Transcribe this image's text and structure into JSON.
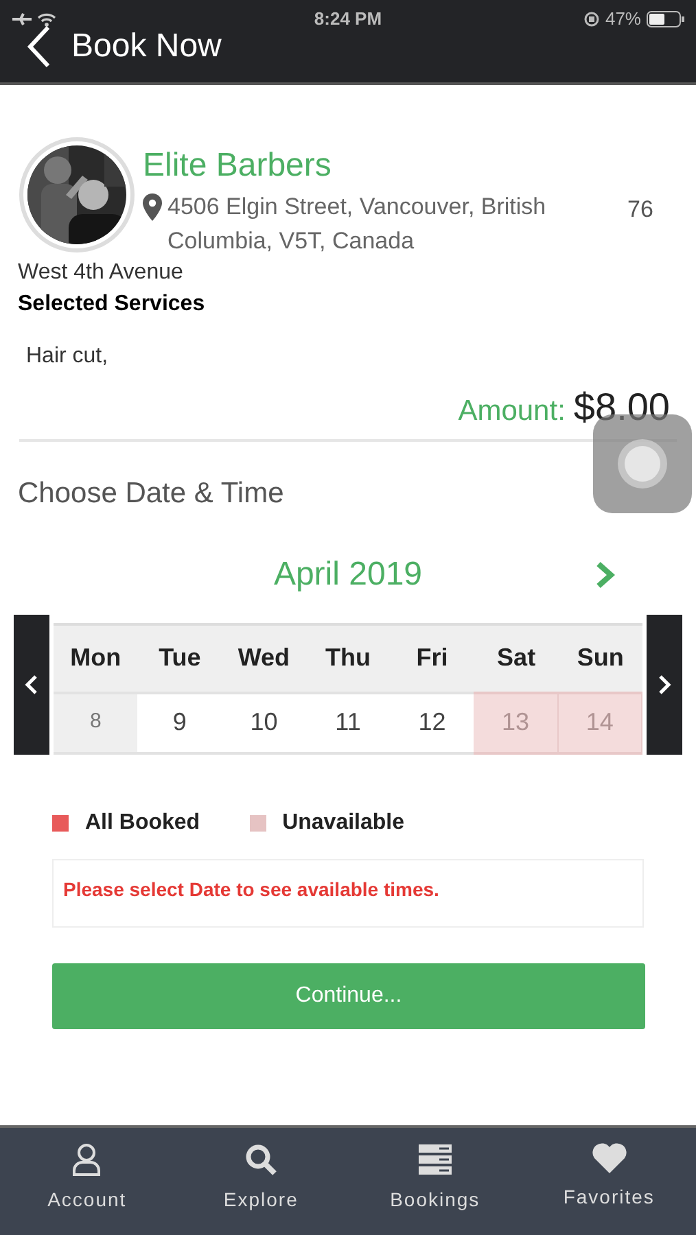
{
  "status_bar": {
    "time": "8:24 PM",
    "battery": "47%"
  },
  "header": {
    "title": "Book Now"
  },
  "shop": {
    "name": "Elite Barbers",
    "address": "4506 Elgin Street, Vancouver, British Columbia, V5T, Canada",
    "count": "76",
    "area": "West 4th Avenue"
  },
  "services": {
    "heading": "Selected Services",
    "items": "Hair cut,",
    "amount_label": "Amount:",
    "amount": "$8.00"
  },
  "schedule": {
    "heading": "Choose Date & Time",
    "month": "April 2019",
    "week": [
      {
        "day": "Mon",
        "date": "8",
        "kind": "past"
      },
      {
        "day": "Tue",
        "date": "9",
        "kind": "open"
      },
      {
        "day": "Wed",
        "date": "10",
        "kind": "open"
      },
      {
        "day": "Thu",
        "date": "11",
        "kind": "open"
      },
      {
        "day": "Fri",
        "date": "12",
        "kind": "open"
      },
      {
        "day": "Sat",
        "date": "13",
        "kind": "unavailable"
      },
      {
        "day": "Sun",
        "date": "14",
        "kind": "unavailable"
      }
    ],
    "legend": [
      {
        "label": "All Booked",
        "color": "#e85a5a"
      },
      {
        "label": "Unavailable",
        "color": "#e6c3c3"
      }
    ],
    "message": "Please select Date to see available times.",
    "button": "Continue..."
  },
  "tab_bar": [
    {
      "label": "Account",
      "kind": "person"
    },
    {
      "label": "Explore",
      "kind": "search"
    },
    {
      "label": "Bookings",
      "kind": "list"
    },
    {
      "label": "Favorites",
      "kind": "heart"
    }
  ]
}
